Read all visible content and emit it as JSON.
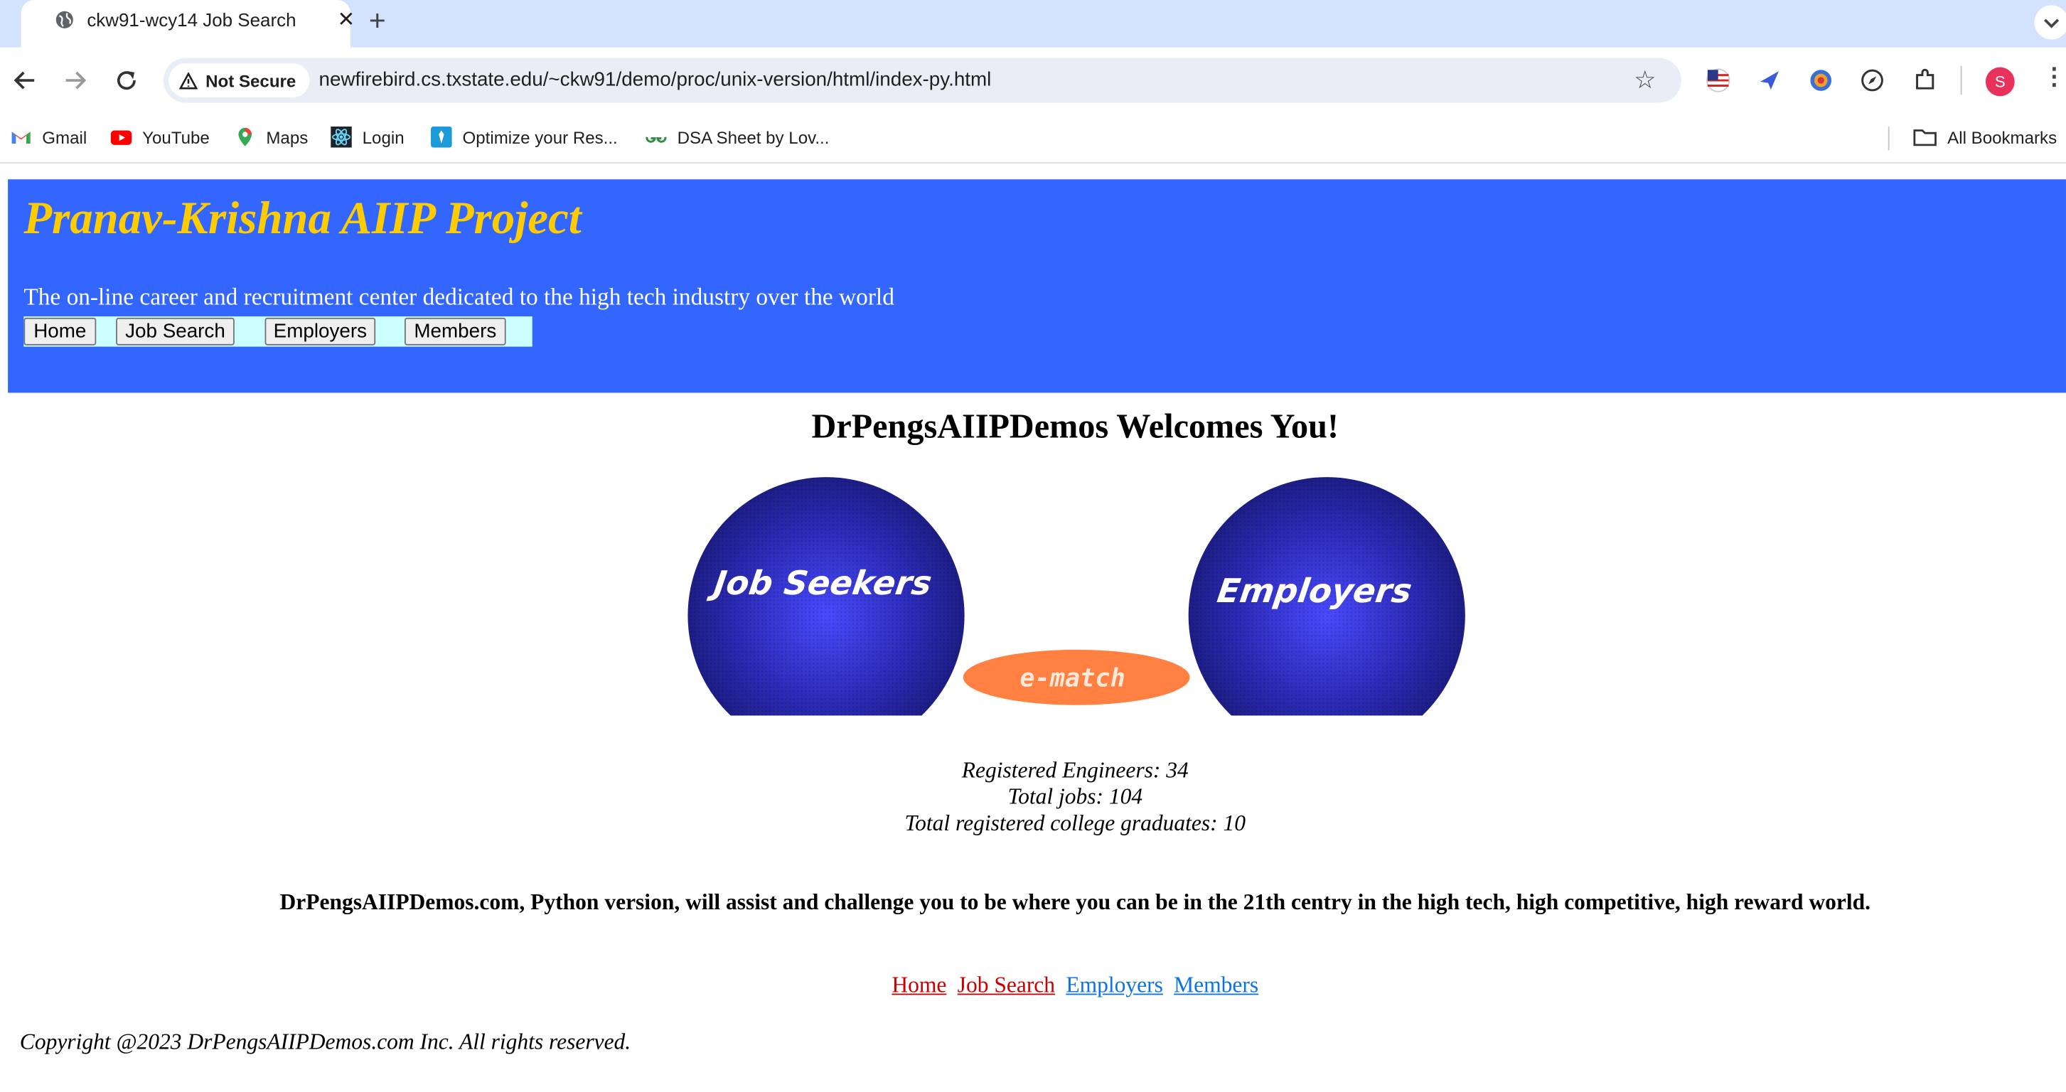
{
  "browser": {
    "tab_title": "ckw91-wcy14 Job Search",
    "new_tab_symbol": "+",
    "security_label": "Not Secure",
    "url": "newfirebird.cs.txstate.edu/~ckw91/demo/proc/unix-version/html/index-py.html",
    "profile_initial": "S",
    "bookmarks": [
      {
        "label": "Gmail",
        "icon": "gmail-icon"
      },
      {
        "label": "YouTube",
        "icon": "youtube-icon"
      },
      {
        "label": "Maps",
        "icon": "maps-icon"
      },
      {
        "label": "Login",
        "icon": "react-icon"
      },
      {
        "label": "Optimize your Res...",
        "icon": "resume-icon"
      },
      {
        "label": "DSA Sheet by Lov...",
        "icon": "geeksforgeeks-icon"
      }
    ],
    "all_bookmarks_label": "All Bookmarks"
  },
  "header": {
    "title": "Pranav-Krishna AIIP Project",
    "tagline": "The on-line career and recruitment center dedicated to the high tech industry over the world",
    "nav_buttons": [
      "Home",
      "Job Search",
      "Employers",
      "Members"
    ]
  },
  "main": {
    "welcome": "DrPengsAIIPDemos Welcomes You!",
    "graphic": {
      "left_label": "Job Seekers",
      "center_label": "e-match",
      "right_label": "Employers"
    },
    "stats": [
      "Registered Engineers: 34",
      "Total jobs: 104",
      "Total registered college graduates: 10"
    ],
    "mission": "DrPengsAIIPDemos.com, Python version, will assist and challenge you to be where you can be in the 21th centry in the high tech, high competitive, high reward world."
  },
  "footer": {
    "links": [
      "Home",
      "Job Search",
      "Employers",
      "Members"
    ],
    "copyright": "Copyright @2023 DrPengsAIIPDemos.com Inc. All rights reserved."
  },
  "colors": {
    "banner": "#3366ff",
    "title": "#ffcc00",
    "navbar_bg": "#ccffff",
    "globe": "#2a2aa8",
    "ematch": "#ff8040",
    "visited_link": "#cc0000",
    "link": "#0a73e6"
  }
}
